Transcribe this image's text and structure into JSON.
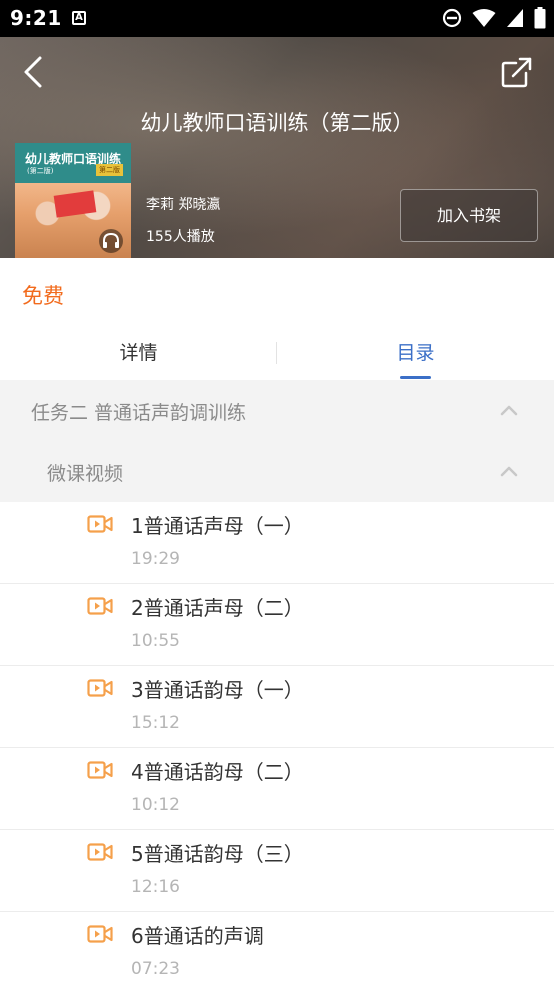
{
  "status_bar": {
    "time": "9:21",
    "notification_icon": "a-icon",
    "icons": [
      "do-not-disturb-icon",
      "wifi-icon",
      "signal-icon",
      "battery-icon"
    ]
  },
  "header": {
    "title": "幼儿教师口语训练（第二版）",
    "back_icon": "back-arrow-icon",
    "share_icon": "share-icon",
    "cover": {
      "title": "幼儿教师口语训练",
      "subtitle": "(第二版)",
      "badge": "第二版"
    },
    "authors": "李莉 郑晓瀛",
    "plays": "155人播放",
    "shelf_button": "加入书架"
  },
  "price": "免费",
  "tabs": [
    {
      "label": "详情",
      "active": false
    },
    {
      "label": "目录",
      "active": true
    }
  ],
  "chapter": {
    "title": "任务二 普通话声韵调训练",
    "subsection": "微课视频"
  },
  "lessons": [
    {
      "title": "1普通话声母（一）",
      "duration": "19:29"
    },
    {
      "title": "2普通话声母（二）",
      "duration": "10:55"
    },
    {
      "title": "3普通话韵母（一）",
      "duration": "15:12"
    },
    {
      "title": "4普通话韵母（二）",
      "duration": "10:12"
    },
    {
      "title": "5普通话韵母（三）",
      "duration": "12:16"
    },
    {
      "title": "6普通话的声调",
      "duration": "07:23"
    }
  ],
  "colors": {
    "accent_blue": "#3b6fc7",
    "price_orange": "#f26b1d",
    "video_icon_orange": "#f5a04b"
  }
}
